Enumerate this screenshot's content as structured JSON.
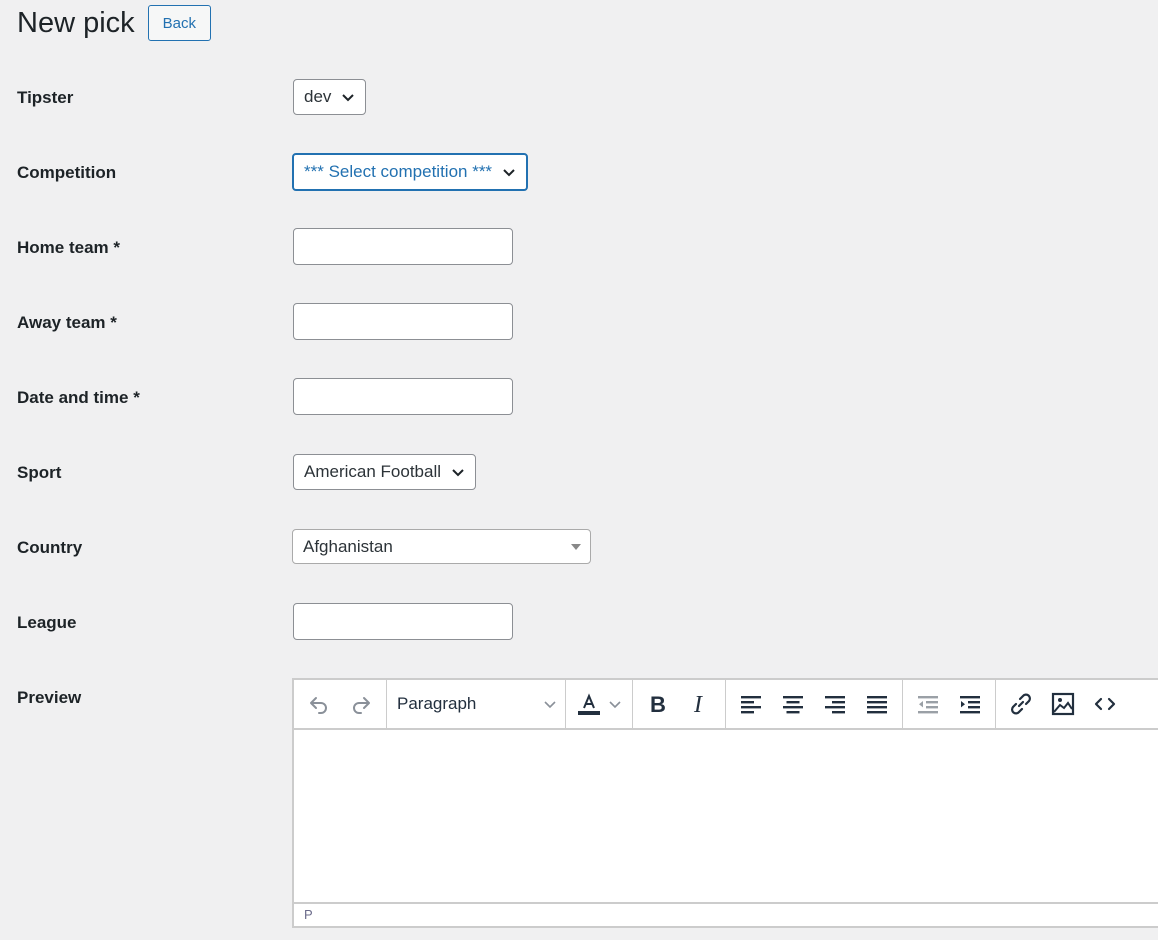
{
  "page": {
    "title": "New pick",
    "back_label": "Back"
  },
  "form": {
    "tipster": {
      "label": "Tipster",
      "value": "dev"
    },
    "competition": {
      "label": "Competition",
      "value": "*** Select competition ***"
    },
    "home_team": {
      "label": "Home team *",
      "value": ""
    },
    "away_team": {
      "label": "Away team *",
      "value": ""
    },
    "date_time": {
      "label": "Date and time *",
      "value": ""
    },
    "sport": {
      "label": "Sport",
      "value": "American Football"
    },
    "country": {
      "label": "Country",
      "value": "Afghanistan"
    },
    "league": {
      "label": "League",
      "value": ""
    },
    "preview": {
      "label": "Preview"
    }
  },
  "editor": {
    "format_value": "Paragraph",
    "status_path": "P",
    "toolbar_icons": [
      "undo-icon",
      "redo-icon",
      "text-color-icon",
      "bold-icon",
      "italic-icon",
      "align-left-icon",
      "align-center-icon",
      "align-right-icon",
      "align-justify-icon",
      "outdent-icon",
      "indent-icon",
      "link-icon",
      "image-icon",
      "code-icon"
    ]
  },
  "colors": {
    "accent": "#2271b1",
    "background": "#f0f0f1",
    "text": "#1d2327"
  }
}
